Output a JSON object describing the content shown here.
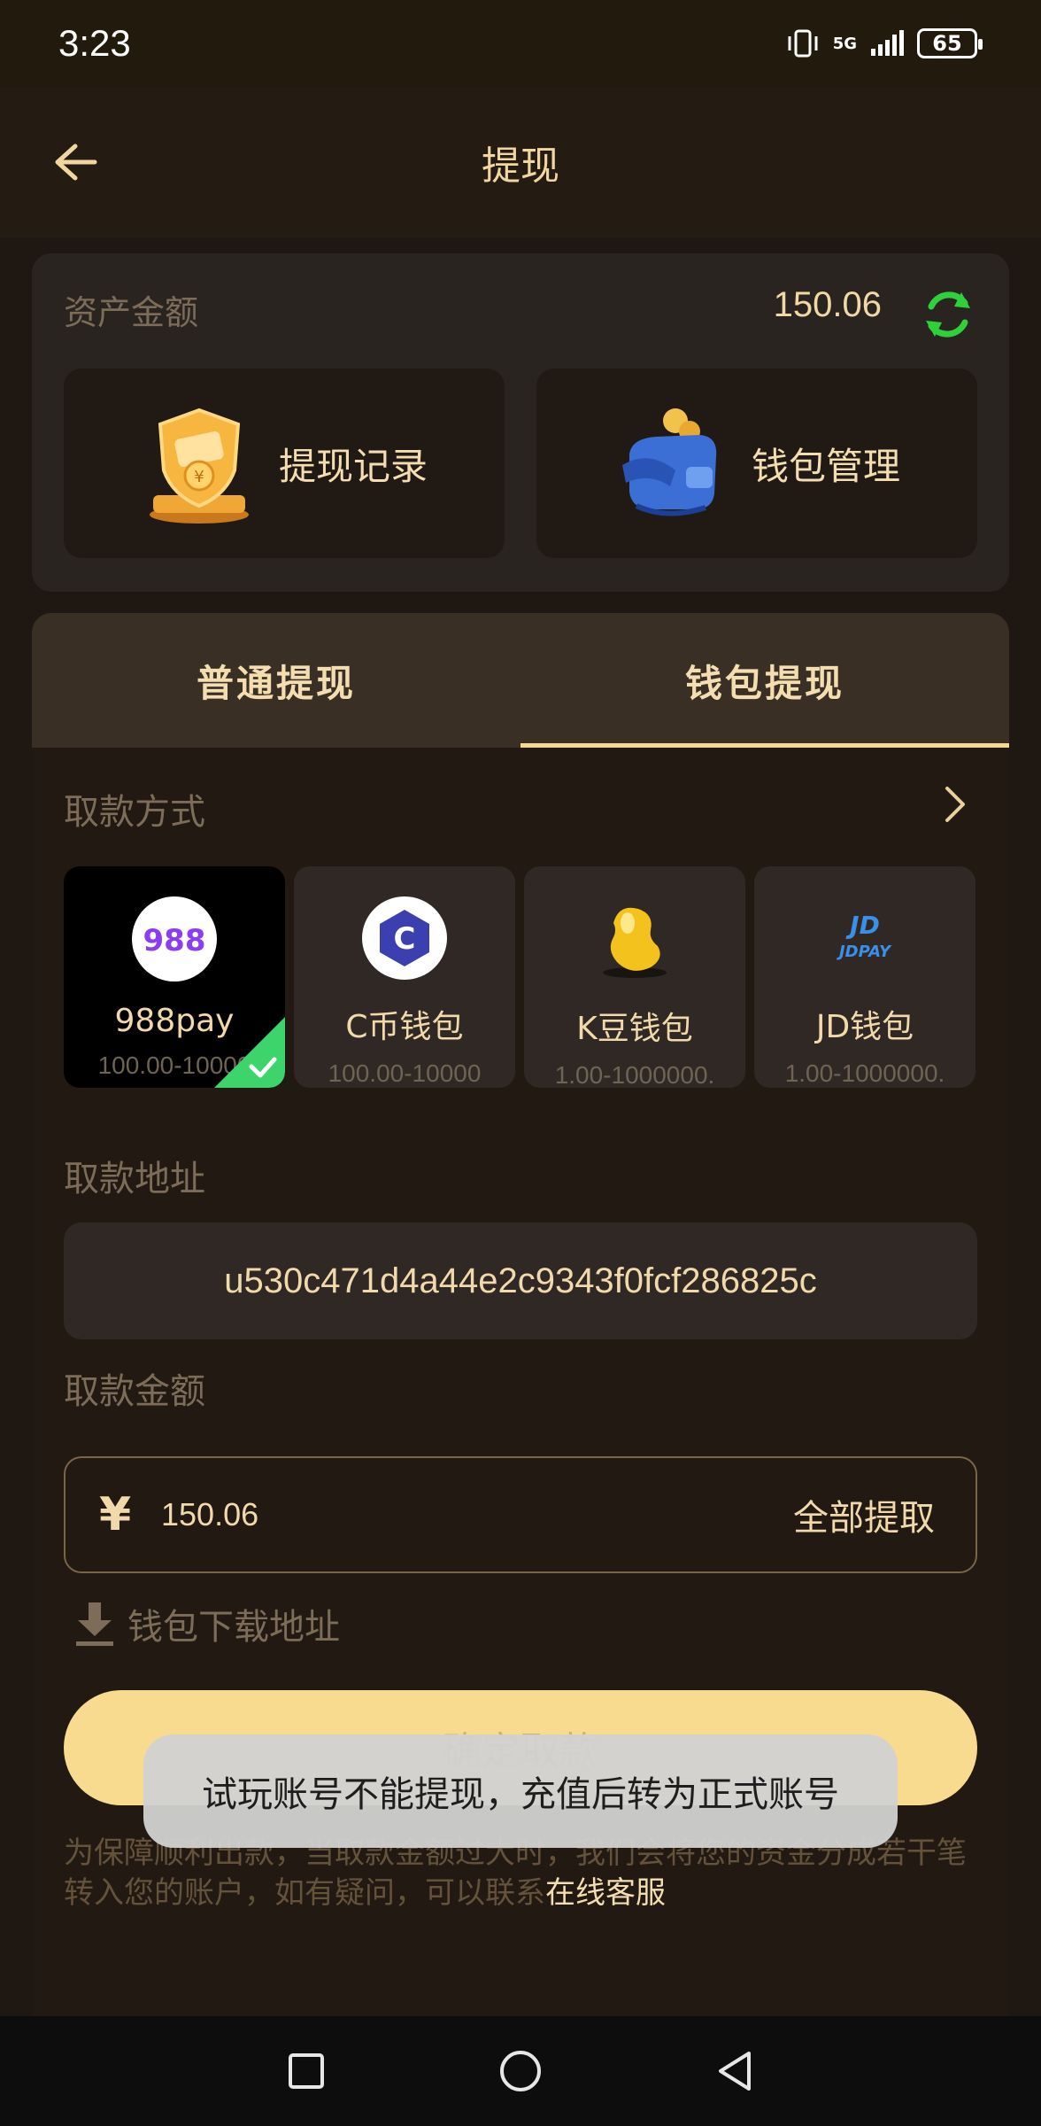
{
  "status_bar": {
    "time": "3:23",
    "network": "5G",
    "battery": "65"
  },
  "header": {
    "title": "提现",
    "back_icon": "arrow-left-icon"
  },
  "assets": {
    "label": "资产金额",
    "amount": "150.06",
    "actions": [
      {
        "label": "提现记录",
        "icon": "shield-coin-icon"
      },
      {
        "label": "钱包管理",
        "icon": "wallet-icon"
      }
    ]
  },
  "tabs": [
    {
      "label": "普通提现",
      "active": false
    },
    {
      "label": "钱包提现",
      "active": true
    }
  ],
  "payment": {
    "label": "取款方式",
    "methods": [
      {
        "name": "988pay",
        "range": "100.00-10000",
        "selected": true,
        "logo_text": "988"
      },
      {
        "name": "C币钱包",
        "range": "100.00-10000",
        "selected": false,
        "logo_text": "C"
      },
      {
        "name": "K豆钱包",
        "range": "1.00-1000000.",
        "selected": false,
        "logo_text": ""
      },
      {
        "name": "JD钱包",
        "range": "1.00-1000000.",
        "selected": false,
        "logo_text": "JDPAY"
      }
    ]
  },
  "address": {
    "label": "取款地址",
    "value": "u530c471d4a44e2c9343f0fcf286825c"
  },
  "amount": {
    "label": "取款金额",
    "currency": "¥",
    "value": "150.06",
    "withdraw_all": "全部提取"
  },
  "download": {
    "label": "钱包下载地址"
  },
  "confirm": {
    "label": "确定取款"
  },
  "notice": {
    "text": "为保障顺利出款，当取款金额过大时，我们会将您的资金分成若干笔转入您的账户，如有疑问，可以联系",
    "link": "在线客服"
  },
  "toast": {
    "message": "试玩账号不能提现，充值后转为正式账号"
  },
  "colors": {
    "background": "#1e1712",
    "accent": "#f8db8f",
    "refresh": "#2fd13b",
    "selected_check": "#3dd46b"
  }
}
